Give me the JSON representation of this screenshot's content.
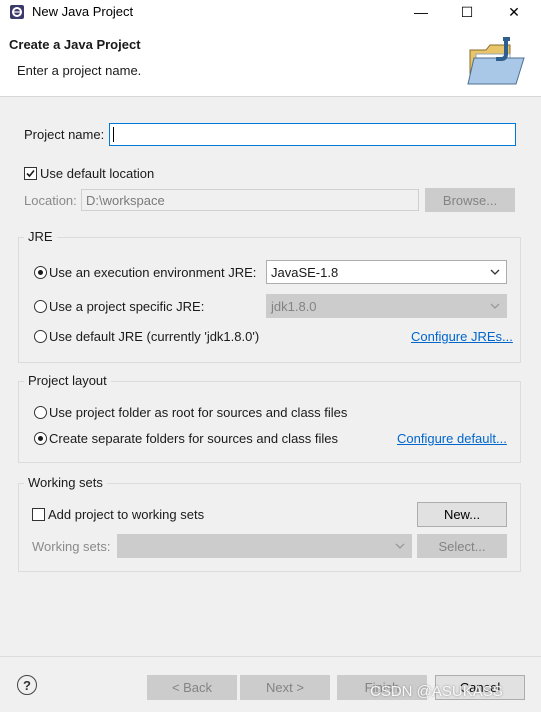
{
  "window": {
    "title": "New Java Project",
    "controls": {
      "minimize": "—",
      "maximize": "☐",
      "close": "✕"
    }
  },
  "banner": {
    "title": "Create a Java Project",
    "message": "Enter a project name."
  },
  "project": {
    "name_label": "Project name:",
    "name_value": "",
    "use_default_location_label": "Use default location",
    "use_default_location_checked": true,
    "location_label": "Location:",
    "location_value": "D:\\workspace",
    "browse_label": "Browse..."
  },
  "jre": {
    "group_title": "JRE",
    "exec_env_label": "Use an execution environment JRE:",
    "exec_env_value": "JavaSE-1.8",
    "specific_label": "Use a project specific JRE:",
    "specific_value": "jdk1.8.0",
    "default_label": "Use default JRE (currently 'jdk1.8.0')",
    "configure_link": "Configure JREs...",
    "selected": "exec_env"
  },
  "layout": {
    "group_title": "Project layout",
    "root_label": "Use project folder as root for sources and class files",
    "separate_label": "Create separate folders for sources and class files",
    "configure_link": "Configure default...",
    "selected": "separate"
  },
  "working_sets": {
    "group_title": "Working sets",
    "add_label": "Add project to working sets",
    "add_checked": false,
    "new_button": "New...",
    "sets_label": "Working sets:",
    "sets_value": "",
    "select_button": "Select..."
  },
  "footer": {
    "help_icon": "?",
    "back": "< Back",
    "next": "Next >",
    "finish": "Finish",
    "cancel": "Cancel",
    "watermark": "CSDN @ASUKASS"
  },
  "colors": {
    "accent": "#0078d7",
    "link": "#0066cc"
  }
}
